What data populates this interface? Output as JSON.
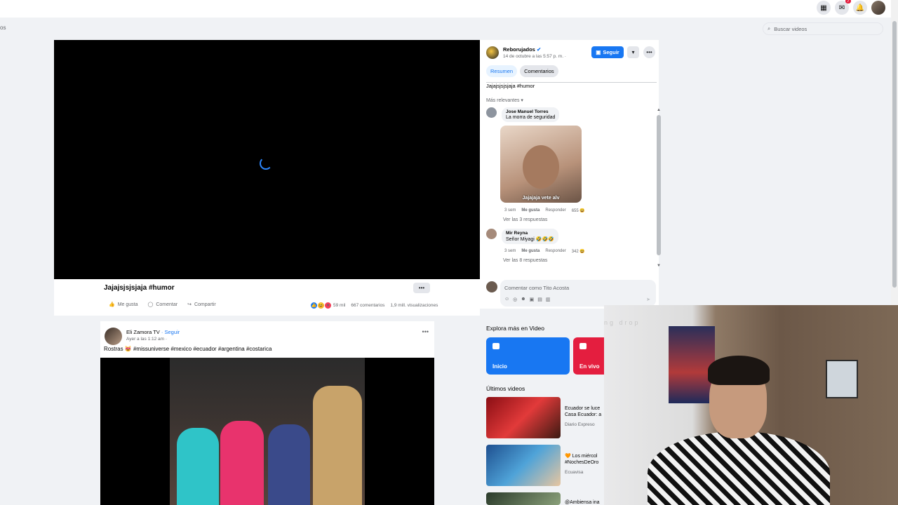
{
  "topbar": {
    "notifications_badge": "7"
  },
  "subbar": {
    "left_text": "os",
    "search_placeholder": "Buscar videos"
  },
  "side_panel": {
    "page_name": "Reborujados",
    "post_date": "14 de octubre a las 5:57 p. m. ·",
    "follow_label": "Seguir",
    "tabs": [
      "Resumen",
      "Comentarios"
    ],
    "caption": "Jajajsjsjsjaja #humor",
    "sort_label": "Más relevantes ▾",
    "comments": [
      {
        "author": "Jose Manuel Torres",
        "text": "La morra de seguridad",
        "image_caption": "Jajajaja vete alv",
        "time": "3 sem",
        "like": "Me gusta",
        "reply": "Responder",
        "reactions": "655",
        "replies": "Ver las 3 respuestas"
      },
      {
        "author": "Mir Reyna",
        "text": "Señor Miyagi 🤣🤣🤣",
        "time": "3 sem",
        "like": "Me gusta",
        "reply": "Responder",
        "reactions": "342",
        "replies": "Ver las 8 respuestas"
      }
    ],
    "comment_placeholder": "Comentar como Tito Acosta"
  },
  "post": {
    "title": "Jajajsjsjsjaja #humor",
    "actions": [
      "Me gusta",
      "Comentar",
      "Compartir"
    ],
    "reaction_count": "59 mil",
    "comments_count": "667 comentarios",
    "views_count": "1,9 mill. visualizaciones"
  },
  "post2": {
    "author": "Eli Zamora TV",
    "follow": "· Seguir",
    "date": "Ayer a las 1:12 am ·",
    "caption": "Rostras 😻 #missuniverse #mexico #ecuador #argentina #costarica"
  },
  "explore": {
    "title": "Explora más en Video",
    "tiles": [
      "Inicio",
      "En vivo"
    ],
    "latest_title": "Últimos videos",
    "videos": [
      {
        "title": "Ecuador se luce",
        "title2": "Casa Ecuador: a",
        "source": "Diario Expreso"
      },
      {
        "title": "🧡 Los miércol",
        "title2": "#NochesDeOro",
        "source": "Ecuavisa"
      },
      {
        "title": "@Ambiensa ina",
        "title2": "",
        "source": ""
      }
    ]
  },
  "webcam": {
    "overlay_text": "ng drop"
  },
  "colors": {
    "accent": "#1877f2",
    "background": "#f0f2f5",
    "live_red": "#e41e3f"
  }
}
